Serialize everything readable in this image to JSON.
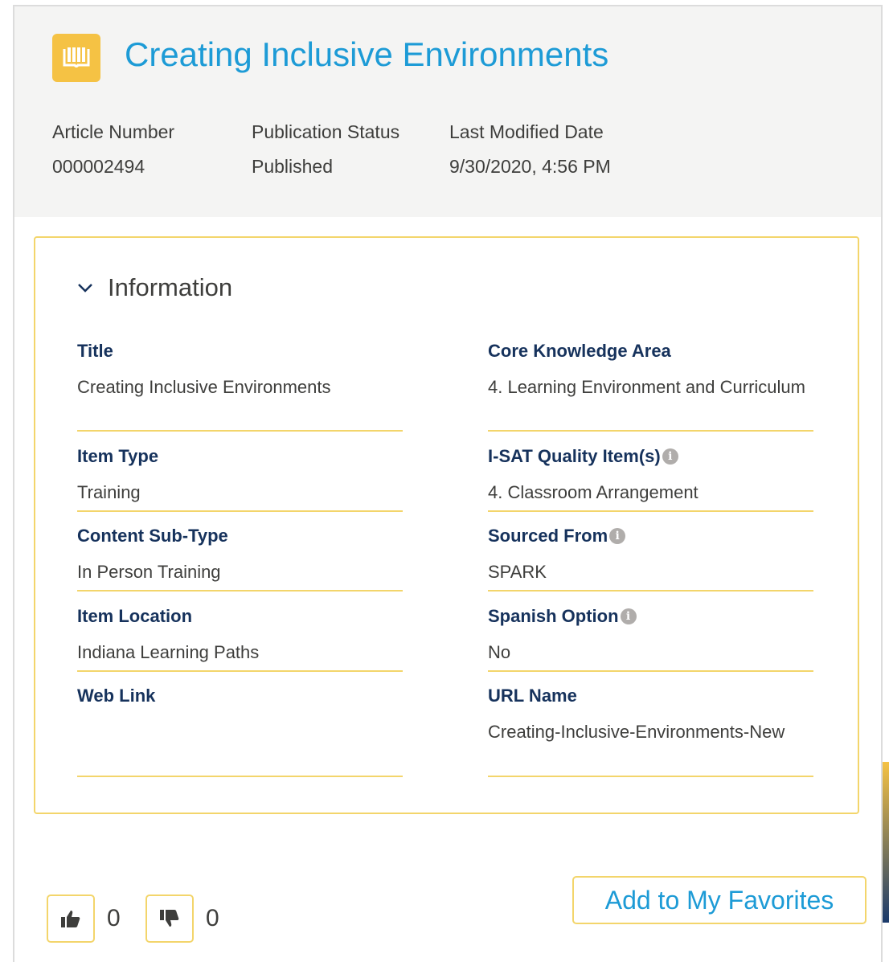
{
  "header": {
    "title": "Creating Inclusive Environments",
    "meta": [
      {
        "label": "Article Number",
        "value": "000002494"
      },
      {
        "label": "Publication Status",
        "value": "Published"
      },
      {
        "label": "Last Modified Date",
        "value": "9/30/2020, 4:56 PM"
      }
    ]
  },
  "section": {
    "title": "Information",
    "left": [
      {
        "label": "Title",
        "value": "Creating Inclusive Environments"
      },
      {
        "label": "Item Type",
        "value": "Training"
      },
      {
        "label": "Content Sub-Type",
        "value": "In Person Training"
      },
      {
        "label": "Item Location",
        "value": "Indiana Learning Paths"
      },
      {
        "label": "Web Link",
        "value": ""
      }
    ],
    "right": [
      {
        "label": "Core Knowledge Area",
        "value": "4. Learning Environment and Curriculum"
      },
      {
        "label": "I-SAT Quality Item(s)",
        "value": "4. Classroom Arrangement"
      },
      {
        "label": "Sourced From",
        "value": "SPARK"
      },
      {
        "label": "Spanish Option",
        "value": "No"
      },
      {
        "label": "URL Name",
        "value": "Creating-Inclusive-Environments-New"
      }
    ]
  },
  "votes": {
    "up_count": "0",
    "down_count": "0"
  },
  "favorites_label": "Add to My Favorites",
  "colors": {
    "accent": "#1d9bd6",
    "gold": "#f5c244",
    "border": "#f3d56b",
    "label": "#16325c"
  },
  "icons": [
    "article-book-icon",
    "chevron-down-icon",
    "info-icon",
    "thumbs-up-icon",
    "thumbs-down-icon"
  ]
}
